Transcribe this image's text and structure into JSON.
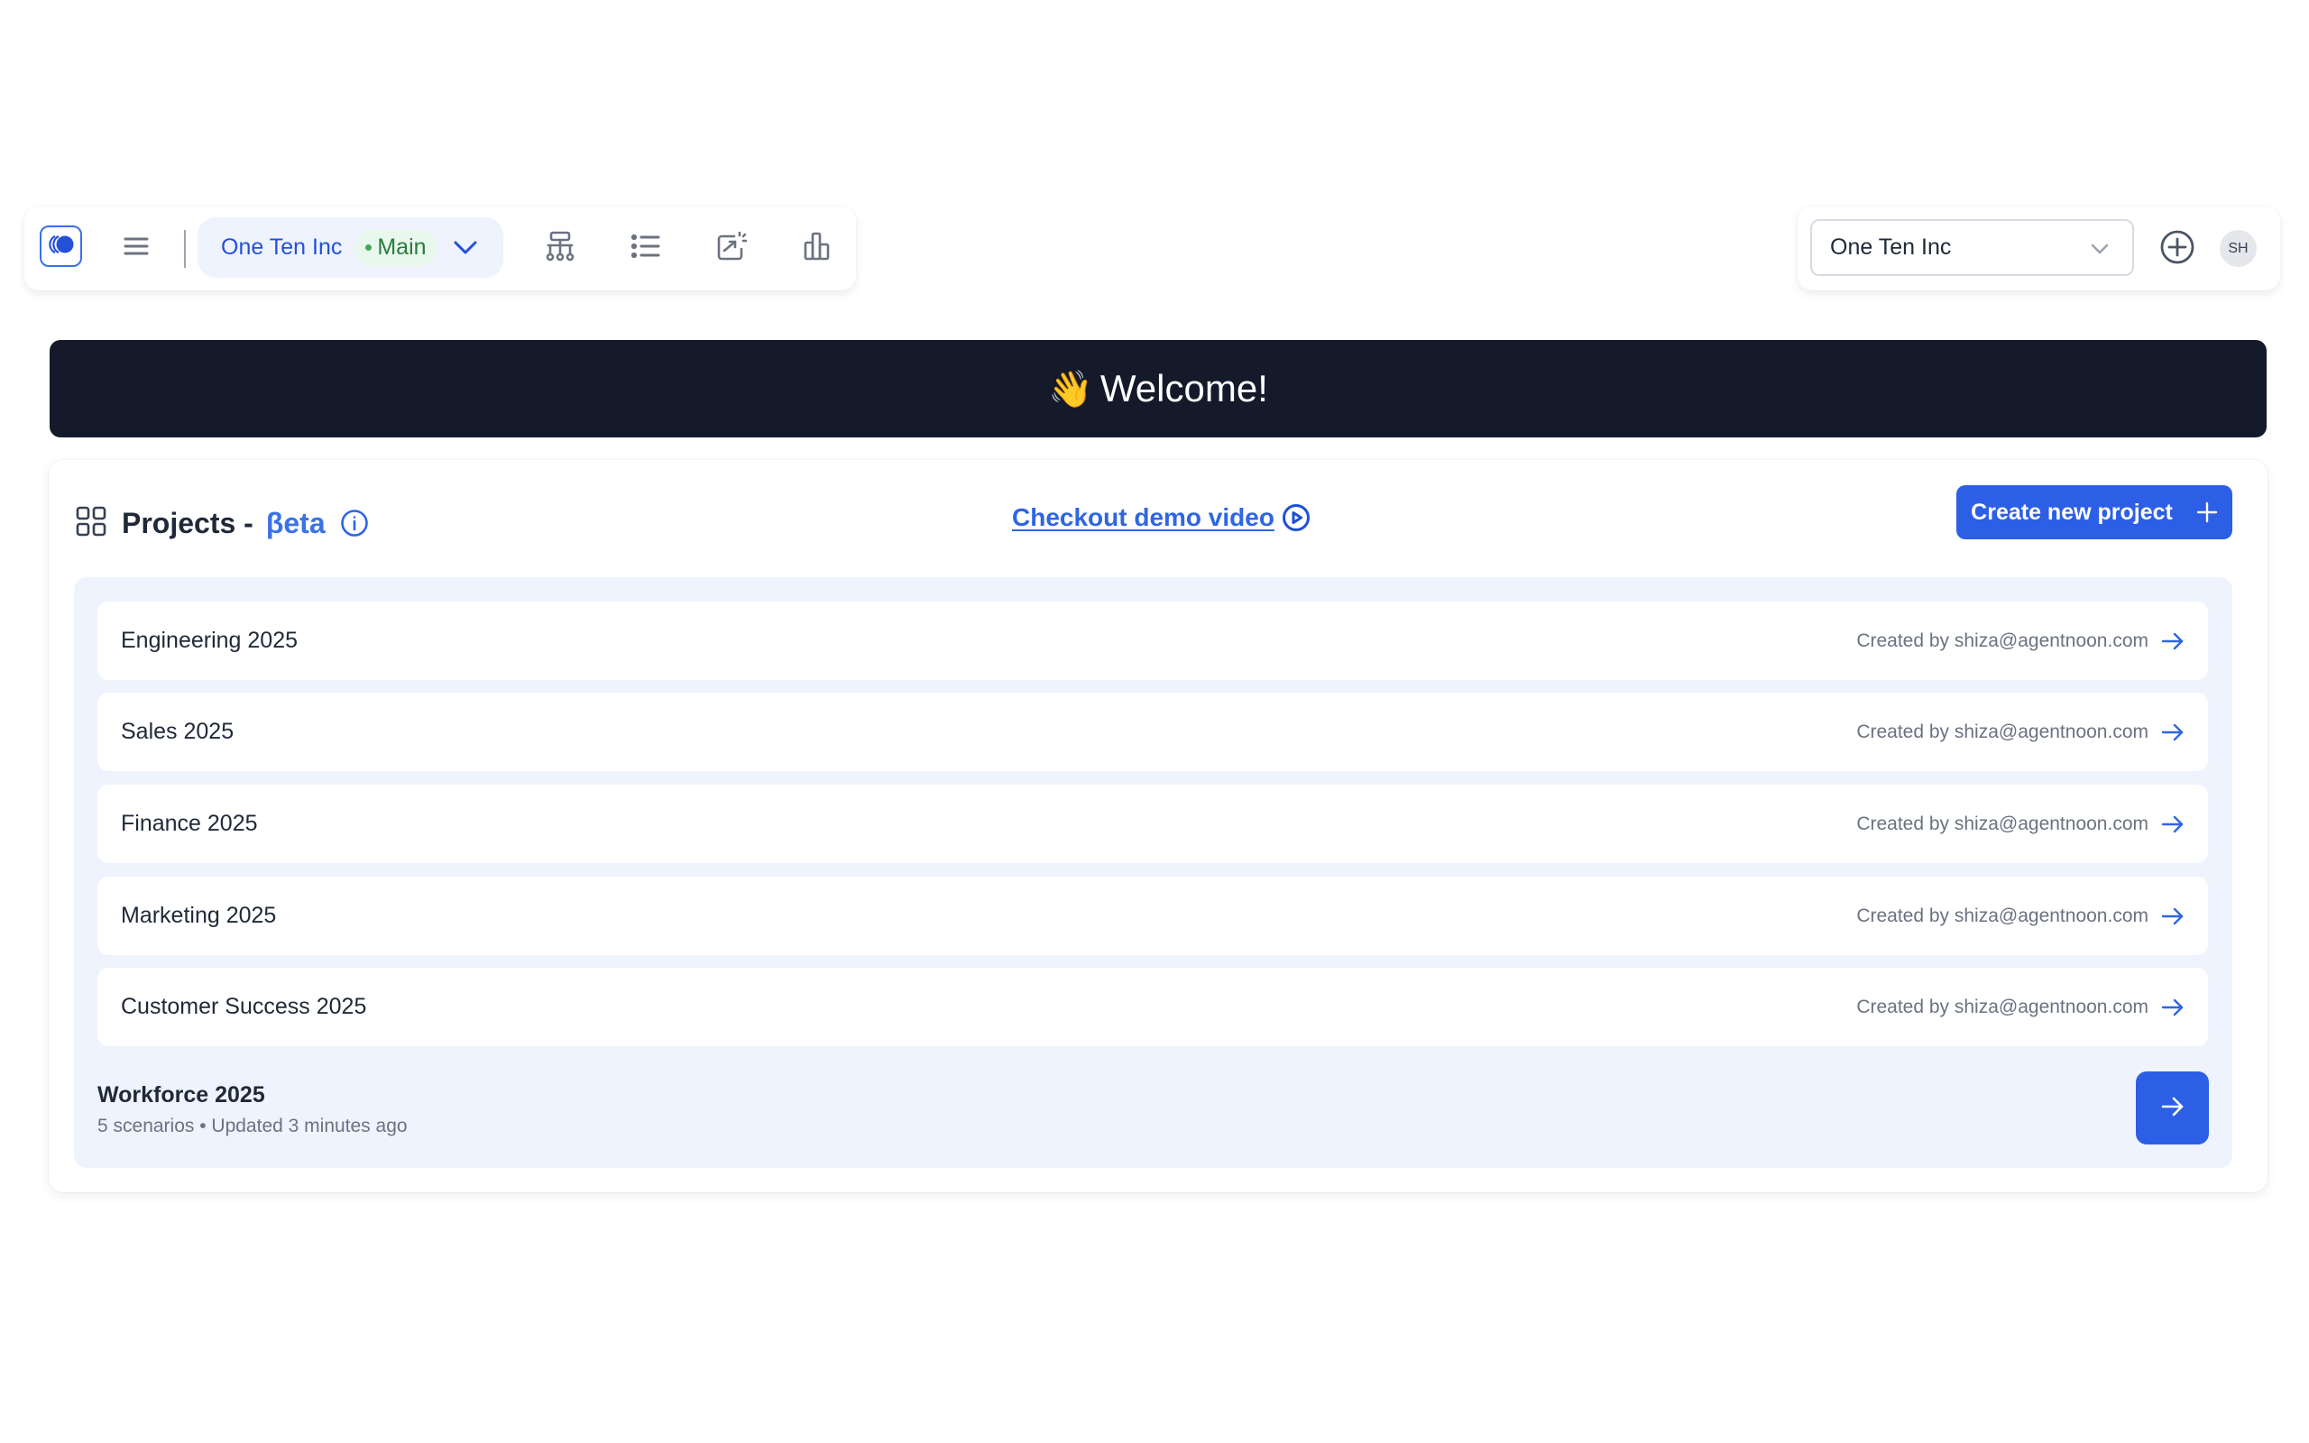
{
  "toolbar": {
    "branch": {
      "org_name": "One Ten Inc",
      "branch_label": "Main"
    },
    "icons": [
      "logo-icon",
      "menu-icon",
      "hierarchy-icon",
      "list-icon",
      "chart-export-icon",
      "bar-chart-icon"
    ]
  },
  "header_right": {
    "org_select_value": "One Ten Inc",
    "avatar_initials": "SH"
  },
  "banner": {
    "emoji": "👋",
    "text": "Welcome!"
  },
  "projects": {
    "title": "Projects -",
    "beta_label": "βeta",
    "demo_link": "Checkout demo video",
    "create_button": "Create new project",
    "rows": [
      {
        "name": "Engineering 2025",
        "meta": "Created by shiza@agentnoon.com"
      },
      {
        "name": "Sales 2025",
        "meta": "Created by shiza@agentnoon.com"
      },
      {
        "name": "Finance 2025",
        "meta": "Created by shiza@agentnoon.com"
      },
      {
        "name": "Marketing 2025",
        "meta": "Created by shiza@agentnoon.com"
      },
      {
        "name": "Customer Success 2025",
        "meta": "Created by shiza@agentnoon.com"
      }
    ],
    "current": {
      "title": "Workforce 2025",
      "subtitle": "5 scenarios • Updated 3 minutes ago"
    }
  },
  "colors": {
    "brand_blue": "#2c5fe6",
    "banner_bg": "#141a2a",
    "list_bg": "#eef3fe",
    "main_badge_green": "#2b7a3e"
  }
}
